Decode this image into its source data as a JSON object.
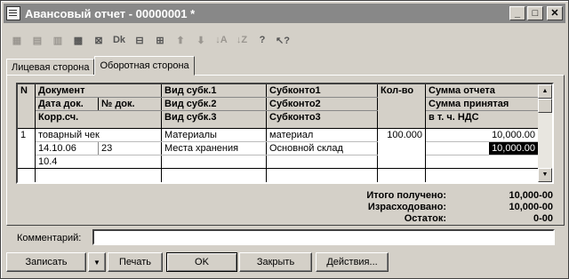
{
  "window": {
    "title": "Авансовый отчет - 00000001 *",
    "controls": {
      "minimize": "_",
      "maximize": "□",
      "close": "✕"
    }
  },
  "toolbar": {
    "icons": [
      "new-row-icon",
      "copy-row-icon",
      "edit-row-icon",
      "delete-row-icon",
      "mark-delete-icon",
      "dk-icon",
      "clear-icon",
      "insert-icon",
      "move-up-icon",
      "move-down-icon",
      "sort-asc-icon",
      "sort-desc-icon",
      "help-icon",
      "pointer-help-icon"
    ]
  },
  "tabs": [
    {
      "label": "Лицевая сторона",
      "active": false
    },
    {
      "label": "Оборотная сторона",
      "active": true
    }
  ],
  "table": {
    "headers": {
      "n": "N",
      "doc": "Документ",
      "doc_date": "Дата док.",
      "doc_num": "№ док.",
      "corr": "Корр.сч.",
      "vid1": "Вид субк.1",
      "vid2": "Вид субк.2",
      "vid3": "Вид субк.3",
      "sub1": "Субконто1",
      "sub2": "Субконто2",
      "sub3": "Субконто3",
      "qty": "Кол-во",
      "sum": "Сумма отчета",
      "sum_accepted": "Сумма принятая",
      "vat": "в т. ч. НДС"
    },
    "rows": [
      {
        "n": "1",
        "doc": "товарный чек",
        "doc_date": "14.10.06",
        "doc_num": "23",
        "corr": "10.4",
        "vid1": "Материалы",
        "vid2": "Места хранения",
        "vid3": "",
        "sub1": "материал",
        "sub2": "Основной склад",
        "sub3": "",
        "qty": "100.000",
        "sum": "10,000.00",
        "sum_accepted": "10,000.00",
        "vat": ""
      }
    ]
  },
  "totals": {
    "received_label": "Итого получено:",
    "received": "10,000-00",
    "spent_label": "Израсходовано:",
    "spent": "10,000-00",
    "balance_label": "Остаток:",
    "balance": "0-00"
  },
  "comment": {
    "label": "Комментарий:",
    "value": ""
  },
  "buttons": {
    "save": "Записать",
    "save_menu": "▼",
    "print": "Печать",
    "ok": "OK",
    "close": "Закрыть",
    "actions": "Действия..."
  }
}
